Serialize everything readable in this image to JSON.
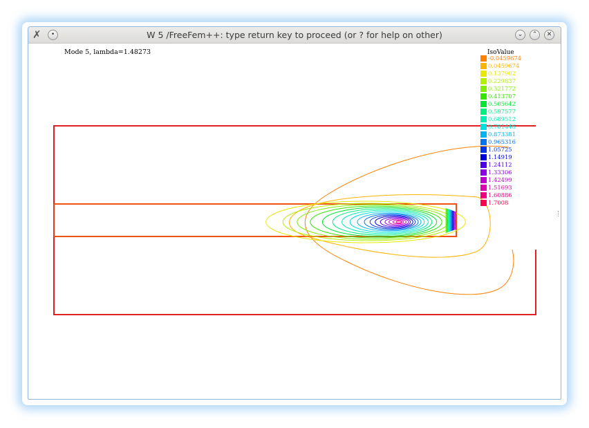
{
  "window": {
    "title": "W 5 /FreeFem++: type return key to proceed (or ? for help on other)",
    "app_icon": "tools-icon",
    "buttons": [
      {
        "name": "menu-button",
        "glyph": "·"
      },
      {
        "name": "minimize-button",
        "glyph": "⌄"
      },
      {
        "name": "maximize-button",
        "glyph": "⌃"
      },
      {
        "name": "close-button",
        "glyph": "✕"
      }
    ]
  },
  "plot": {
    "mode_label": "Mode 5, lambda=1.48273",
    "legend_title": "IsoValue",
    "legend": [
      {
        "label": "-0.0459674",
        "color": "#ff8000"
      },
      {
        "label": "0.0459674",
        "color": "#ffb300"
      },
      {
        "label": "0.137902",
        "color": "#e8e800"
      },
      {
        "label": "0.229837",
        "color": "#b3f000"
      },
      {
        "label": "0.321772",
        "color": "#80f000"
      },
      {
        "label": "0.413707",
        "color": "#33e600"
      },
      {
        "label": "0.505642",
        "color": "#00e633"
      },
      {
        "label": "0.597577",
        "color": "#00f080"
      },
      {
        "label": "0.689512",
        "color": "#00f0b3"
      },
      {
        "label": "0.781446",
        "color": "#00e0e0"
      },
      {
        "label": "0.873381",
        "color": "#00b3f0"
      },
      {
        "label": "0.965316",
        "color": "#0073f0"
      },
      {
        "label": "1.05725",
        "color": "#0033e6"
      },
      {
        "label": "1.14919",
        "color": "#0000d9"
      },
      {
        "label": "1.24112",
        "color": "#4d00e6"
      },
      {
        "label": "1.33306",
        "color": "#8c00e6"
      },
      {
        "label": "1.42499",
        "color": "#c000d0"
      },
      {
        "label": "1.51693",
        "color": "#e000b0"
      },
      {
        "label": "1.60886",
        "color": "#f00080"
      },
      {
        "label": "1.7008",
        "color": "#ff0050"
      }
    ],
    "colors": {
      "outer_boundary": "#e02020",
      "inner_boundary": "#f05010"
    }
  }
}
